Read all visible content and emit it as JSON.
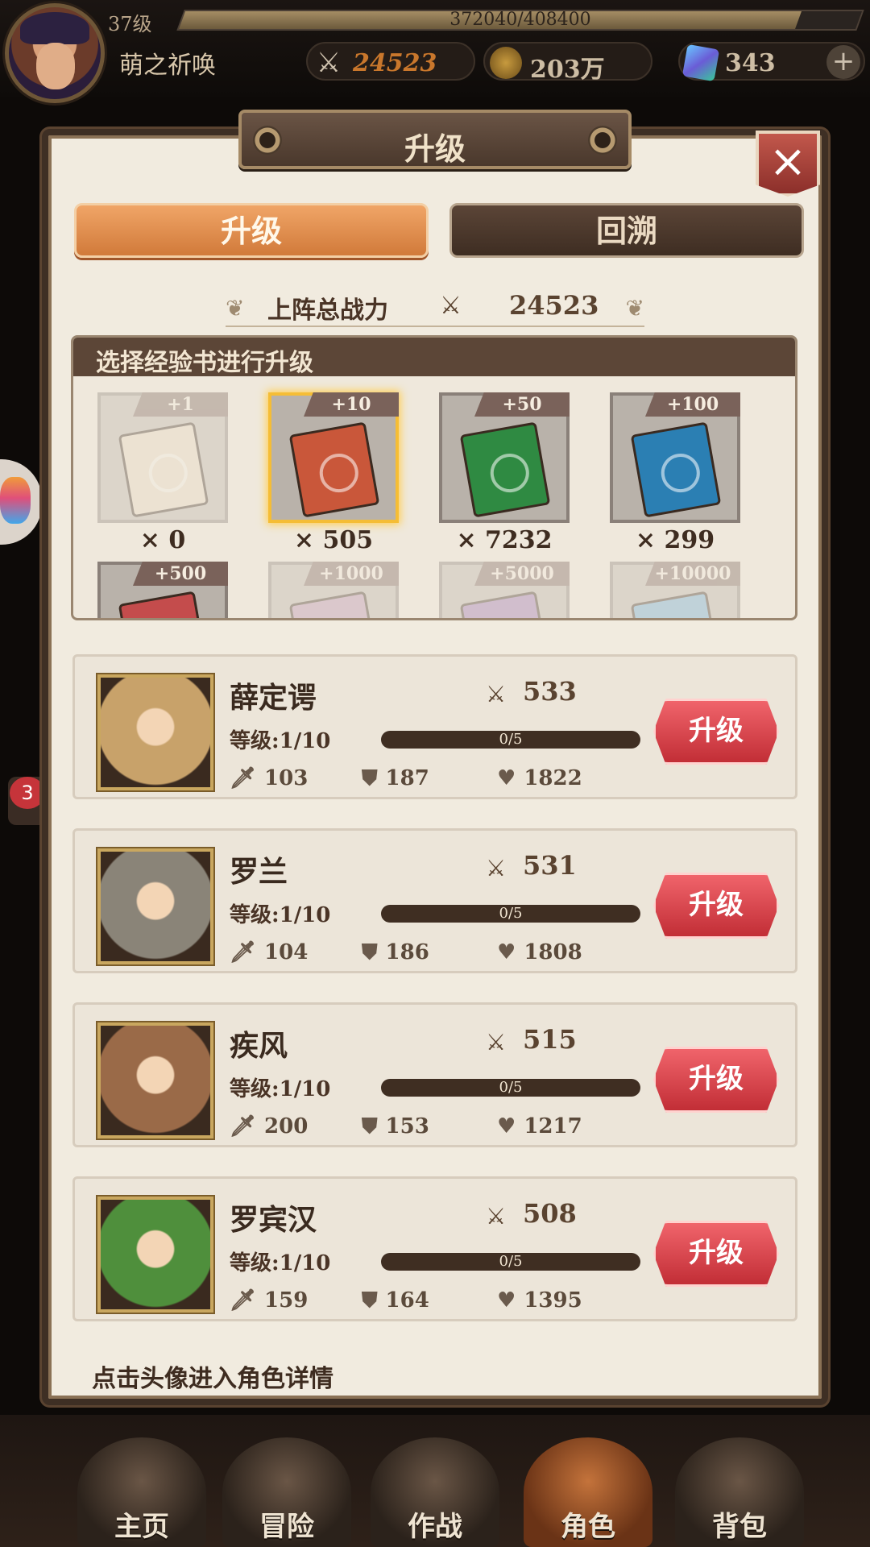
{
  "topbar": {
    "level_label": "37级",
    "exp_text": "372040/408400",
    "exp_fraction": 0.911,
    "player_name": "萌之祈唤",
    "power_value": "24523",
    "gold_value": "203万",
    "gem_value": "343",
    "plus_label": "+"
  },
  "side": {
    "badge_count": "3"
  },
  "panel": {
    "title": "升级",
    "close_label": "×",
    "tabs": [
      {
        "label": "升级",
        "active": true
      },
      {
        "label": "回溯",
        "active": false
      }
    ],
    "team_power_label": "上阵总战力",
    "team_power_value": "24523",
    "book_section_title": "选择经验书进行升级",
    "books": [
      {
        "tag": "+1",
        "count": "× 0",
        "color": "#e7d9c0",
        "state": "dim"
      },
      {
        "tag": "+10",
        "count": "× 505",
        "color": "#c9573a",
        "state": "selected"
      },
      {
        "tag": "+50",
        "count": "× 7232",
        "color": "#2f8a42",
        "state": "normal"
      },
      {
        "tag": "+100",
        "count": "× 299",
        "color": "#2b7fb3",
        "state": "normal"
      },
      {
        "tag": "+500",
        "count": "",
        "color": "#c44c4c",
        "state": "partial"
      },
      {
        "tag": "+1000",
        "count": "",
        "color": "#b78fb0",
        "state": "dim"
      },
      {
        "tag": "+5000",
        "count": "",
        "color": "#9a72b4",
        "state": "dim"
      },
      {
        "tag": "+10000",
        "count": "",
        "color": "#6aaad4",
        "state": "dim"
      }
    ],
    "heroes": [
      {
        "name": "薛定谔",
        "level": "等级:1/10",
        "progress": "0/5",
        "power": "533",
        "atk": "103",
        "def": "187",
        "hp": "1822",
        "upgrade_label": "升级",
        "portrait_color": "#c8a26a"
      },
      {
        "name": "罗兰",
        "level": "等级:1/10",
        "progress": "0/5",
        "power": "531",
        "atk": "104",
        "def": "186",
        "hp": "1808",
        "upgrade_label": "升级",
        "portrait_color": "#8a8478"
      },
      {
        "name": "疾风",
        "level": "等级:1/10",
        "progress": "0/5",
        "power": "515",
        "atk": "200",
        "def": "153",
        "hp": "1217",
        "upgrade_label": "升级",
        "portrait_color": "#9a6a48"
      },
      {
        "name": "罗宾汉",
        "level": "等级:1/10",
        "progress": "0/5",
        "power": "508",
        "atk": "159",
        "def": "164",
        "hp": "1395",
        "upgrade_label": "升级",
        "portrait_color": "#4f8f3c"
      }
    ],
    "footer_hint": "点击头像进入角色详情"
  },
  "nav": [
    {
      "label": "主页",
      "icon": "castle-icon"
    },
    {
      "label": "冒险",
      "icon": "gate-icon"
    },
    {
      "label": "作战",
      "icon": "battle-icon"
    },
    {
      "label": "角色",
      "icon": "character-book-icon",
      "active": true
    },
    {
      "label": "背包",
      "icon": "backpack-icon"
    }
  ]
}
